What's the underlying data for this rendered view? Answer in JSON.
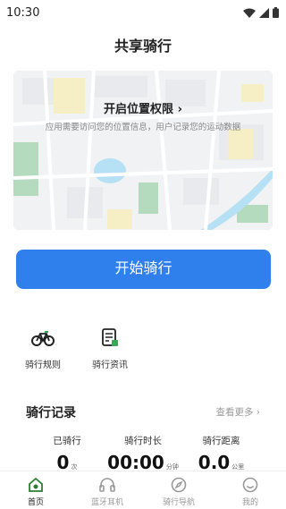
{
  "status_bar": {
    "time": "10:30"
  },
  "page_title": "共享骑行",
  "location_card": {
    "title": "开启位置权限",
    "description": "应用需要访问您的位置信息，用户记录您的运动数据"
  },
  "start_button": {
    "label": "开始骑行"
  },
  "tools": [
    {
      "label": "骑行规则",
      "icon": "bicycle-icon"
    },
    {
      "label": "骑行资讯",
      "icon": "news-icon"
    }
  ],
  "records": {
    "title": "骑行记录",
    "more_label": "查看更多",
    "stats": [
      {
        "label": "已骑行",
        "value": "0",
        "unit": "次"
      },
      {
        "label": "骑行时长",
        "value": "00:00",
        "unit": "分钟"
      },
      {
        "label": "骑行距离",
        "value": "0.0",
        "unit": "公里"
      }
    ]
  },
  "tabbar": [
    {
      "label": "首页",
      "icon": "home-icon",
      "active": true
    },
    {
      "label": "蓝牙耳机",
      "icon": "headphones-icon",
      "active": false
    },
    {
      "label": "骑行导航",
      "icon": "compass-icon",
      "active": false
    },
    {
      "label": "我的",
      "icon": "profile-icon",
      "active": false
    }
  ],
  "colors": {
    "accent": "#2f80ed",
    "highlight": "#9fe8a9",
    "active_tab": "#2e7d32"
  }
}
